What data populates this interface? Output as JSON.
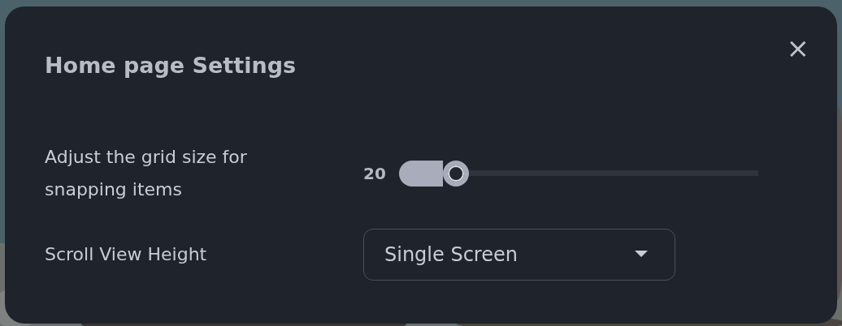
{
  "dialog": {
    "title": "Home page Settings",
    "close": "×"
  },
  "settings": [
    {
      "kind": "slider",
      "label": "Adjust the grid size for snapping items",
      "reading": "20",
      "level": 0.14
    },
    {
      "kind": "select",
      "label": "Scroll View Height",
      "value": "Single Screen"
    }
  ]
}
